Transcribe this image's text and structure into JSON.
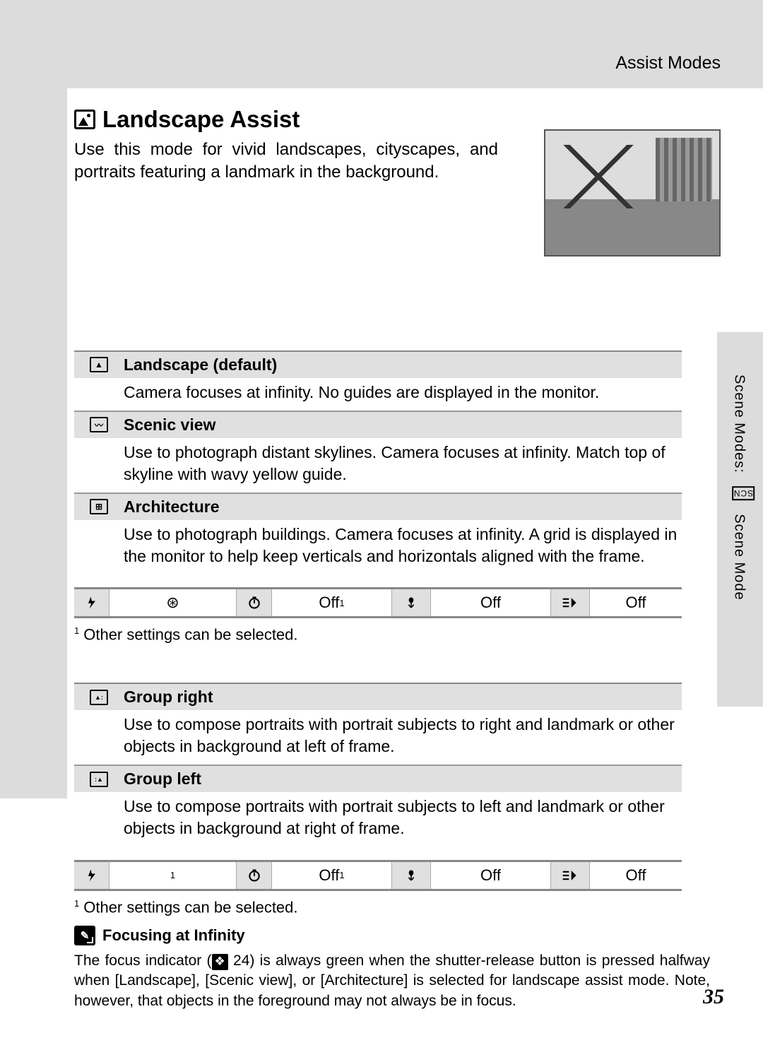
{
  "header": {
    "section": "Assist Modes"
  },
  "title": "Landscape Assist",
  "intro": "Use this mode for vivid landscapes, cityscapes, and portraits featuring a landmark in the background.",
  "modes1": [
    {
      "name": "Landscape (default)",
      "desc": "Camera focuses at infinity. No guides are displayed in the monitor."
    },
    {
      "name": "Scenic view",
      "desc": "Use to photograph distant skylines. Camera focuses at infinity. Match top of skyline with wavy yellow guide."
    },
    {
      "name": "Architecture",
      "desc": "Use to photograph buildings. Camera focuses at infinity. A grid is displayed in the monitor to help keep verticals and horizontals aligned with the frame."
    }
  ],
  "settings1": {
    "flash": "⊛",
    "timer": "Off",
    "timer_sup": "1",
    "macro": "Off",
    "exposure": "Off"
  },
  "footnote1": "Other settings can be selected.",
  "modes2": [
    {
      "name": "Group right",
      "desc": "Use to compose portraits with portrait subjects to right and landmark or other objects in background at left of frame."
    },
    {
      "name": "Group left",
      "desc": "Use to compose portraits with portrait subjects to left and landmark or other objects in background at right of frame."
    }
  ],
  "settings2": {
    "flash_sup": "1",
    "timer": "Off",
    "timer_sup": "1",
    "macro": "Off",
    "exposure": "Off"
  },
  "footnote2": "Other settings can be selected.",
  "info": {
    "title": "Focusing at Infinity",
    "ref_page": "24",
    "text_a": "The focus indicator (",
    "text_b": " 24) is always green when the shutter-release button is pressed halfway when [Landscape], [Scenic view], or [Architecture] is selected for landscape assist mode. Note, however, that objects in the foreground may not always be in focus."
  },
  "side_label": {
    "a": "Scene Modes: ",
    "b": " Scene Mode"
  },
  "page_number": "35"
}
